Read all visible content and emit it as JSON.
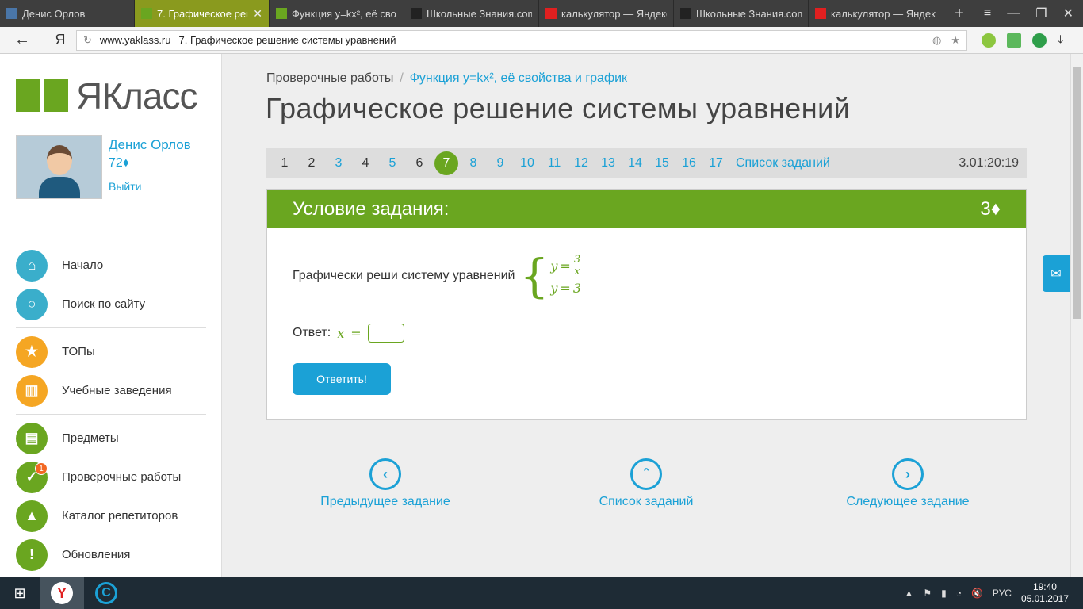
{
  "browser": {
    "tabs": [
      {
        "title": "Денис Орлов",
        "favicon": "vk-icon",
        "color": "#4a76a8"
      },
      {
        "title": "7. Графическое реш",
        "favicon": "yaklass-icon",
        "color": "#6aa620",
        "active": true
      },
      {
        "title": "Функция y=kx², её сво",
        "favicon": "yaklass-icon",
        "color": "#6aa620"
      },
      {
        "title": "Школьные Знания.com",
        "favicon": "znanija-icon",
        "color": "#222"
      },
      {
        "title": "калькулятор — Яндекс",
        "favicon": "yandex-icon",
        "color": "#e02020"
      },
      {
        "title": "Школьные Знания.com",
        "favicon": "znanija-icon",
        "color": "#222"
      },
      {
        "title": "калькулятор — Яндекс",
        "favicon": "yandex-icon",
        "color": "#e02020"
      }
    ],
    "address": {
      "domain": "www.yaklass.ru",
      "title": "7. Графическое решение системы уравнений"
    },
    "ya_button": "Я"
  },
  "sidebar": {
    "logo_text": "ЯКласс",
    "user": {
      "name": "Денис Орлов",
      "score": "72♦",
      "logout": "Выйти"
    },
    "nav": [
      {
        "label": "Начало",
        "icon": "home-icon",
        "color": "#3aaecb",
        "glyph": "⌂"
      },
      {
        "label": "Поиск по сайту",
        "icon": "search-icon",
        "color": "#3aaecb",
        "glyph": "○"
      },
      {
        "label": "ТОПы",
        "icon": "star-icon",
        "color": "#f5a623",
        "glyph": "★"
      },
      {
        "label": "Учебные заведения",
        "icon": "building-icon",
        "color": "#f5a623",
        "glyph": "▥"
      },
      {
        "label": "Предметы",
        "icon": "book-icon",
        "color": "#6aa620",
        "glyph": "▤"
      },
      {
        "label": "Проверочные работы",
        "icon": "check-icon",
        "color": "#6aa620",
        "glyph": "✓",
        "badge": "1"
      },
      {
        "label": "Каталог репетиторов",
        "icon": "graduation-cap-icon",
        "color": "#6aa620",
        "glyph": "▲"
      },
      {
        "label": "Обновления",
        "icon": "exclamation-icon",
        "color": "#6aa620",
        "glyph": "!"
      }
    ]
  },
  "main": {
    "breadcrumb": {
      "root": "Проверочные работы",
      "separator": "/",
      "link": "Функция y=kx², её свойства и график"
    },
    "title": "Графическое решение системы уравнений",
    "pager": {
      "pages": [
        {
          "n": "1",
          "state": "done"
        },
        {
          "n": "2",
          "state": "done"
        },
        {
          "n": "3",
          "state": "link"
        },
        {
          "n": "4",
          "state": "done"
        },
        {
          "n": "5",
          "state": "link"
        },
        {
          "n": "6",
          "state": "done"
        },
        {
          "n": "7",
          "state": "current"
        },
        {
          "n": "8",
          "state": "link"
        },
        {
          "n": "9",
          "state": "link"
        },
        {
          "n": "10",
          "state": "link"
        },
        {
          "n": "11",
          "state": "link"
        },
        {
          "n": "12",
          "state": "link"
        },
        {
          "n": "13",
          "state": "link"
        },
        {
          "n": "14",
          "state": "link"
        },
        {
          "n": "15",
          "state": "link"
        },
        {
          "n": "16",
          "state": "link"
        },
        {
          "n": "17",
          "state": "link"
        }
      ],
      "list_label": "Список заданий",
      "timer": "3.01:20:19"
    },
    "task": {
      "header": "Условие задания:",
      "points": "3♦",
      "question": "Графически реши систему уравнений",
      "eq1": {
        "lhs": "y",
        "op": "=",
        "num": "3",
        "den": "x"
      },
      "eq2": {
        "lhs": "y",
        "op": "=",
        "rhs": "3"
      },
      "answer_label": "Ответ:",
      "answer_var": "x",
      "answer_op": "=",
      "answer_value": "",
      "submit_label": "Ответить!"
    },
    "bottom_nav": {
      "prev": "Предыдущее задание",
      "list": "Список заданий",
      "next": "Следующее задание"
    }
  },
  "taskbar": {
    "lang": "РУС",
    "time": "19:40",
    "date": "05.01.2017"
  }
}
